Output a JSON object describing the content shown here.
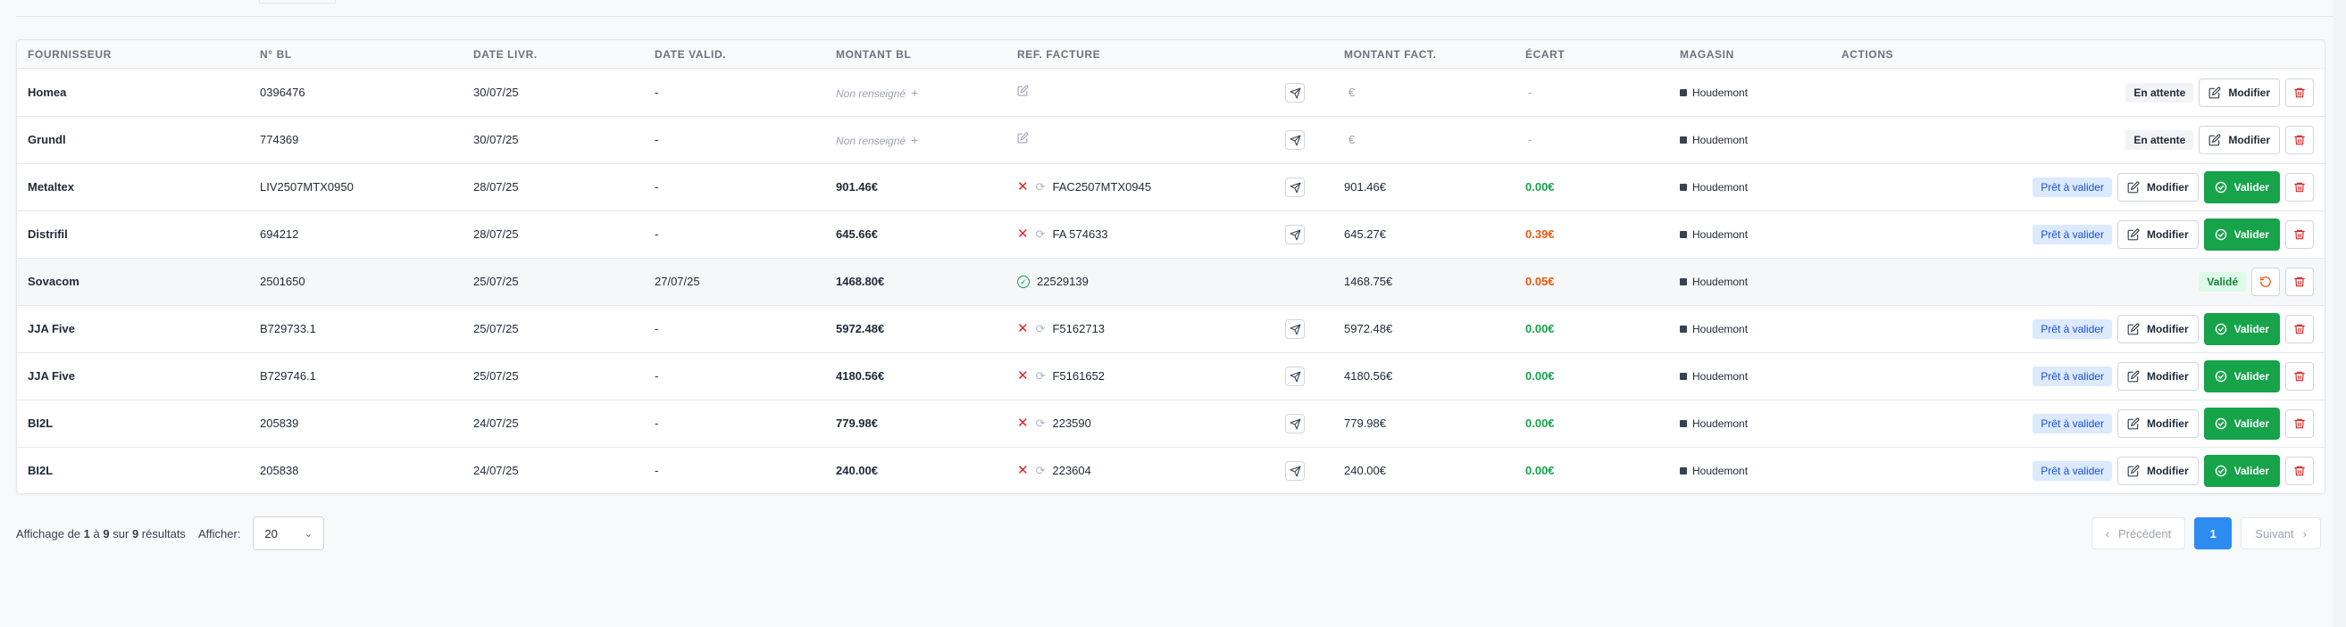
{
  "columns": {
    "supplier": "FOURNISSEUR",
    "bl_number": "N° BL",
    "delivery_date": "DATE LIVR.",
    "validation_date": "DATE VALID.",
    "bl_amount": "MONTANT BL",
    "invoice_ref": "REF. FACTURE",
    "invoice_amount": "MONTANT FACT.",
    "gap": "ÉCART",
    "store": "MAGASIN",
    "actions": "ACTIONS"
  },
  "labels": {
    "not_provided": "Non renseigné",
    "plus": "+",
    "euro": "€",
    "dash": "-",
    "modify": "Modifier",
    "validate": "Valider",
    "status_pending": "En attente",
    "status_ready": "Prêt à valider",
    "status_validated": "Validé"
  },
  "rows": [
    {
      "supplier": "Homea",
      "bl": "0396476",
      "delivery": "30/07/25",
      "validated": "-",
      "bl_amount": "",
      "ref": "",
      "invoice_amount": "",
      "gap": "-",
      "store": "Houdemont",
      "status": "pending"
    },
    {
      "supplier": "Grundl",
      "bl": "774369",
      "delivery": "30/07/25",
      "validated": "-",
      "bl_amount": "",
      "ref": "",
      "invoice_amount": "",
      "gap": "-",
      "store": "Houdemont",
      "status": "pending"
    },
    {
      "supplier": "Metaltex",
      "bl": "LIV2507MTX0950",
      "delivery": "28/07/25",
      "validated": "-",
      "bl_amount": "901.46€",
      "ref": "FAC2507MTX0945",
      "invoice_amount": "901.46€",
      "gap": "0.00€",
      "gap_color": "green",
      "store": "Houdemont",
      "status": "ready"
    },
    {
      "supplier": "Distrifil",
      "bl": "694212",
      "delivery": "28/07/25",
      "validated": "-",
      "bl_amount": "645.66€",
      "ref": "FA 574633",
      "invoice_amount": "645.27€",
      "gap": "0.39€",
      "gap_color": "orange",
      "store": "Houdemont",
      "status": "ready"
    },
    {
      "supplier": "Sovacom",
      "bl": "2501650",
      "delivery": "25/07/25",
      "validated": "27/07/25",
      "bl_amount": "1468.80€",
      "ref": "22529139",
      "invoice_amount": "1468.75€",
      "gap": "0.05€",
      "gap_color": "orange",
      "store": "Houdemont",
      "status": "validated"
    },
    {
      "supplier": "JJA Five",
      "bl": "B729733.1",
      "delivery": "25/07/25",
      "validated": "-",
      "bl_amount": "5972.48€",
      "ref": "F5162713",
      "invoice_amount": "5972.48€",
      "gap": "0.00€",
      "gap_color": "green",
      "store": "Houdemont",
      "status": "ready"
    },
    {
      "supplier": "JJA Five",
      "bl": "B729746.1",
      "delivery": "25/07/25",
      "validated": "-",
      "bl_amount": "4180.56€",
      "ref": "F5161652",
      "invoice_amount": "4180.56€",
      "gap": "0.00€",
      "gap_color": "green",
      "store": "Houdemont",
      "status": "ready"
    },
    {
      "supplier": "BI2L",
      "bl": "205839",
      "delivery": "24/07/25",
      "validated": "-",
      "bl_amount": "779.98€",
      "ref": "223590",
      "invoice_amount": "779.98€",
      "gap": "0.00€",
      "gap_color": "green",
      "store": "Houdemont",
      "status": "ready"
    },
    {
      "supplier": "BI2L",
      "bl": "205838",
      "delivery": "24/07/25",
      "validated": "-",
      "bl_amount": "240.00€",
      "ref": "223604",
      "invoice_amount": "240.00€",
      "gap": "0.00€",
      "gap_color": "green",
      "store": "Houdemont",
      "status": "ready"
    }
  ],
  "footer": {
    "showing_prefix": "Affichage de",
    "from": "1",
    "to_word": "à",
    "to": "9",
    "of_word": "sur",
    "total": "9",
    "results_word": "résultats",
    "per_page_label": "Afficher:",
    "per_page_value": "20",
    "prev_label": "Précédent",
    "next_label": "Suivant",
    "current_page": "1"
  },
  "colors": {
    "green": "#16a34a",
    "orange": "#ea580c",
    "danger": "#dc2626",
    "primary": "#2d8cf0"
  }
}
